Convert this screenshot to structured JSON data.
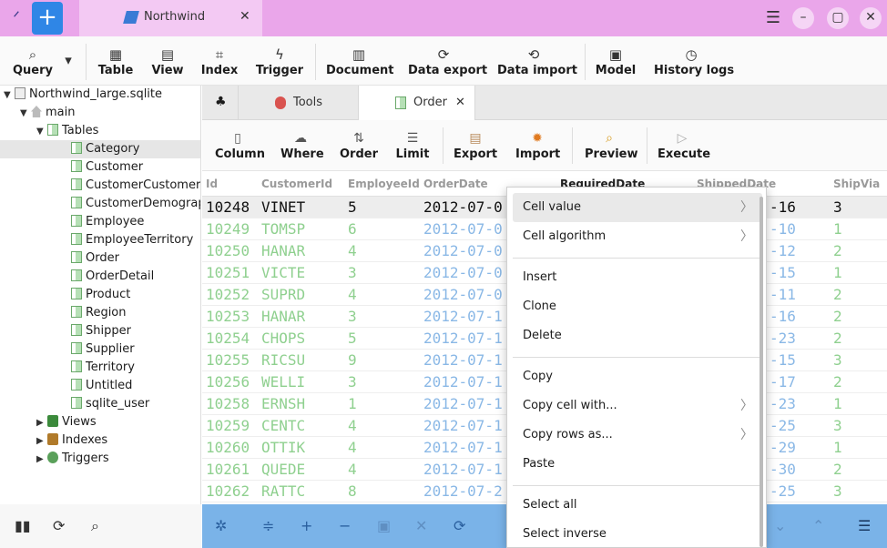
{
  "titlebar": {
    "tab_title": "Northwind",
    "close_glyph": "✕",
    "new_tab_glyph": "+"
  },
  "window_controls": {
    "menu": "☰",
    "minimize": "–",
    "maximize": "▢",
    "close": "✕"
  },
  "toolbar": {
    "query": "Query",
    "table": "Table",
    "view": "View",
    "index": "Index",
    "trigger": "Trigger",
    "document": "Document",
    "data_export": "Data export",
    "data_import": "Data import",
    "model": "Model",
    "history_logs": "History logs"
  },
  "tree": {
    "root": "Northwind_large.sqlite",
    "schema": "main",
    "tables_label": "Tables",
    "tables": [
      "Category",
      "Customer",
      "CustomerCustomerDemo",
      "CustomerDemographic",
      "Employee",
      "EmployeeTerritory",
      "Order",
      "OrderDetail",
      "Product",
      "Region",
      "Shipper",
      "Supplier",
      "Territory",
      "Untitled",
      "sqlite_user"
    ],
    "views_label": "Views",
    "indexes_label": "Indexes",
    "triggers_label": "Triggers"
  },
  "editor_tabs": {
    "tools": "Tools",
    "order": "Order",
    "close_glyph": "✕"
  },
  "query_toolbar": {
    "column": "Column",
    "where": "Where",
    "order": "Order",
    "limit": "Limit",
    "export": "Export",
    "import": "Import",
    "preview": "Preview",
    "execute": "Execute"
  },
  "grid": {
    "headers": [
      "Id",
      "CustomerId",
      "EmployeeId",
      "OrderDate",
      "RequiredDate",
      "ShippedDate",
      "ShipVia"
    ],
    "rows": [
      [
        "10248",
        "VINET",
        "5",
        "2012-07-0",
        "-16",
        "3"
      ],
      [
        "10249",
        "TOMSP",
        "6",
        "2012-07-0",
        "-10",
        "1"
      ],
      [
        "10250",
        "HANAR",
        "4",
        "2012-07-0",
        "-12",
        "2"
      ],
      [
        "10251",
        "VICTE",
        "3",
        "2012-07-0",
        "-15",
        "1"
      ],
      [
        "10252",
        "SUPRD",
        "4",
        "2012-07-0",
        "-11",
        "2"
      ],
      [
        "10253",
        "HANAR",
        "3",
        "2012-07-1",
        "-16",
        "2"
      ],
      [
        "10254",
        "CHOPS",
        "5",
        "2012-07-1",
        "-23",
        "2"
      ],
      [
        "10255",
        "RICSU",
        "9",
        "2012-07-1",
        "-15",
        "3"
      ],
      [
        "10256",
        "WELLI",
        "3",
        "2012-07-1",
        "-17",
        "2"
      ],
      [
        "10258",
        "ERNSH",
        "1",
        "2012-07-1",
        "-23",
        "1"
      ],
      [
        "10259",
        "CENTC",
        "4",
        "2012-07-1",
        "-25",
        "3"
      ],
      [
        "10260",
        "OTTIK",
        "4",
        "2012-07-1",
        "-29",
        "1"
      ],
      [
        "10261",
        "QUEDE",
        "4",
        "2012-07-1",
        "-30",
        "2"
      ],
      [
        "10262",
        "RATTC",
        "8",
        "2012-07-2",
        "-25",
        "3"
      ]
    ]
  },
  "context_menu": {
    "cell_value": "Cell value",
    "cell_algorithm": "Cell algorithm",
    "insert": "Insert",
    "clone": "Clone",
    "delete": "Delete",
    "copy": "Copy",
    "copy_cell_with": "Copy cell with...",
    "copy_rows_as": "Copy rows as...",
    "paste": "Paste",
    "select_all": "Select all",
    "select_inverse": "Select inverse",
    "submenu_glyph": "〉"
  },
  "colors": {
    "titlebar": "#eaa6ea",
    "accent": "#2f86e6",
    "bottombar": "#7ab3e8"
  }
}
